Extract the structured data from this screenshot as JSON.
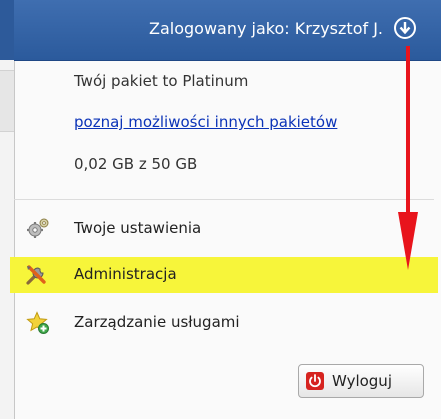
{
  "header": {
    "logged_in_label": "Zalogowany jako: Krzysztof J.",
    "toggle_icon": "arrow-down-circle-icon"
  },
  "account": {
    "package_text": "Twój pakiet to Platinum",
    "other_packages_link": "poznaj możliwości innych pakietów",
    "storage_usage": "0,02 GB z 50 GB"
  },
  "menu": {
    "items": [
      {
        "label": "Twoje ustawienia",
        "icon": "gears-icon"
      },
      {
        "label": "Administracja",
        "icon": "tools-icon",
        "highlighted": true
      },
      {
        "label": "Zarządzanie usługami",
        "icon": "star-plus-icon"
      }
    ]
  },
  "logout": {
    "label": "Wyloguj",
    "icon": "power-icon"
  },
  "colors": {
    "header_blue": "#2d5a9a",
    "highlight_yellow": "#f7f53a",
    "link_blue": "#0b33b8",
    "annotation_red": "#e8141c"
  }
}
